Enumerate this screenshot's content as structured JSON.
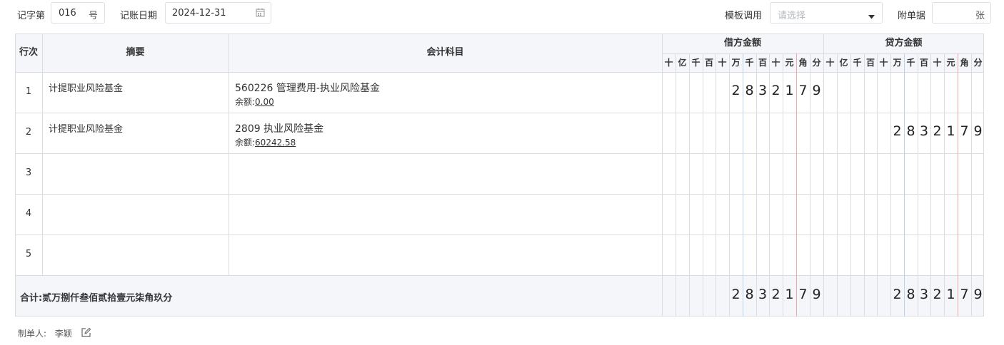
{
  "toolbar": {
    "voucher_word_label": "记字第",
    "voucher_no": "016",
    "voucher_no_suffix": "号",
    "date_label": "记账日期",
    "date_value": "2024-12-31",
    "template_label": "模板调用",
    "template_placeholder": "请选择",
    "attachments_label": "附单据",
    "attachments_suffix": "张"
  },
  "table": {
    "headers": {
      "row_no": "行次",
      "summary": "摘要",
      "account": "会计科目",
      "debit": "借方金额",
      "credit": "贷方金额"
    },
    "digit_headers": [
      "十",
      "亿",
      "千",
      "百",
      "十",
      "万",
      "千",
      "百",
      "十",
      "元",
      "角",
      "分"
    ],
    "rows": [
      {
        "no": "1",
        "summary": "计提职业风险基金",
        "account": "560226 管理费用-执业风险基金",
        "balance_label": "余额:",
        "balance": "0.00",
        "debit_digits": "2832179",
        "credit_digits": ""
      },
      {
        "no": "2",
        "summary": "计提职业风险基金",
        "account": "2809 执业风险基金",
        "balance_label": "余额:",
        "balance": "60242.58",
        "debit_digits": "",
        "credit_digits": "2832179"
      },
      {
        "no": "3",
        "summary": "",
        "account": "",
        "balance_label": "",
        "balance": "",
        "debit_digits": "",
        "credit_digits": ""
      },
      {
        "no": "4",
        "summary": "",
        "account": "",
        "balance_label": "",
        "balance": "",
        "debit_digits": "",
        "credit_digits": ""
      },
      {
        "no": "5",
        "summary": "",
        "account": "",
        "balance_label": "",
        "balance": "",
        "debit_digits": "",
        "credit_digits": ""
      }
    ],
    "total": {
      "label": "合计:贰万捌仟叁佰贰拾壹元柒角玖分",
      "debit_digits": "2832179",
      "credit_digits": "2832179"
    }
  },
  "footer": {
    "maker_label": "制单人:",
    "maker_name": "李颖"
  },
  "colors": {
    "border": "#d9dde3",
    "header_bg": "#f4f6fa",
    "wan_separator": "#b9d4f2",
    "yuan_separator": "#f0a8a8"
  }
}
